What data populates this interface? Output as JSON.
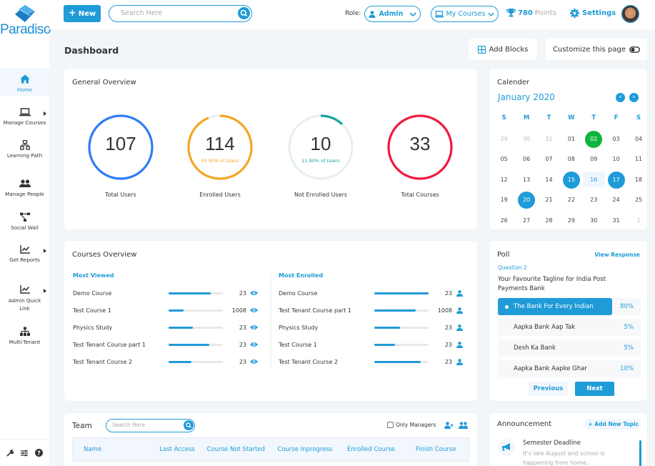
{
  "app": {
    "brand": "Paradiso"
  },
  "sidebar": {
    "items": [
      {
        "label": "Home",
        "icon": "home-icon",
        "active": true
      },
      {
        "label": "Manage Courses",
        "icon": "laptop-icon",
        "submenu": true
      },
      {
        "label": "Learning Path",
        "icon": "sitemap-icon"
      },
      {
        "label": "Manage People",
        "icon": "users-icon"
      },
      {
        "label": "Social Wall",
        "icon": "network-icon"
      },
      {
        "label": "Get Reports",
        "icon": "chart-line-icon",
        "submenu": true
      },
      {
        "label": "Admin Quick Link",
        "icon": "chart-line-icon",
        "submenu": true
      },
      {
        "label": "Multi-Tenant",
        "icon": "org-chart-icon"
      }
    ],
    "bottom_icons": [
      "wrench-icon",
      "sliders-icon",
      "help-icon"
    ]
  },
  "topbar": {
    "new_label": "New",
    "search_placeholder": "Search Here",
    "role_label": "Role:",
    "role_value": "Admin",
    "courses_label": "My Courses",
    "points_value": "780",
    "points_label": "Points",
    "settings_label": "Settings"
  },
  "header": {
    "title": "Dashboard",
    "add_blocks_label": "Add Blocks",
    "customize_label": "Customize this page"
  },
  "general_overview": {
    "title": "General Overview",
    "stats": [
      {
        "value": "107",
        "label": "Total Users",
        "sub": "",
        "color": "#2f7cf6",
        "fraction": 1.0
      },
      {
        "value": "114",
        "label": "Enrolled Users",
        "sub": "93.90% of Users",
        "color": "#f5a623",
        "fraction": 0.939
      },
      {
        "value": "10",
        "label": "Not Enrolled Users",
        "sub": "11.90% of Users",
        "color": "#14a3a3",
        "fraction": 0.119
      },
      {
        "value": "33",
        "label": "Total Courses",
        "sub": "",
        "color": "#f0193f",
        "fraction": 1.0
      }
    ]
  },
  "calendar": {
    "title": "Calender",
    "month": "January 2020",
    "weekdays": [
      "S",
      "M",
      "T",
      "W",
      "T",
      "F",
      "S"
    ],
    "weeks": [
      [
        {
          "d": "29",
          "m": 1
        },
        {
          "d": "30",
          "m": 1
        },
        {
          "d": "31",
          "m": 1
        },
        {
          "d": "01"
        },
        {
          "d": "02",
          "s": "green"
        },
        {
          "d": "03"
        },
        {
          "d": "04"
        }
      ],
      [
        {
          "d": "05"
        },
        {
          "d": "06"
        },
        {
          "d": "07"
        },
        {
          "d": "08"
        },
        {
          "d": "09"
        },
        {
          "d": "10"
        },
        {
          "d": "11"
        }
      ],
      [
        {
          "d": "12"
        },
        {
          "d": "13"
        },
        {
          "d": "14"
        },
        {
          "d": "15",
          "s": "blue"
        },
        {
          "d": "16",
          "s": "range"
        },
        {
          "d": "17",
          "s": "blue"
        },
        {
          "d": "18"
        }
      ],
      [
        {
          "d": "19"
        },
        {
          "d": "20",
          "s": "blue"
        },
        {
          "d": "21"
        },
        {
          "d": "22"
        },
        {
          "d": "23"
        },
        {
          "d": "24"
        },
        {
          "d": "25"
        }
      ],
      [
        {
          "d": "26"
        },
        {
          "d": "27"
        },
        {
          "d": "28"
        },
        {
          "d": "29"
        },
        {
          "d": "30"
        },
        {
          "d": "31"
        },
        {
          "d": "1",
          "m": 1
        }
      ]
    ]
  },
  "courses_overview": {
    "title": "Courses Overview",
    "most_viewed": {
      "label": "Most Viewed",
      "rows": [
        {
          "name": "Demo Course",
          "value": "23",
          "progress": 0.77
        },
        {
          "name": "Test Course 1",
          "value": "1008",
          "progress": 0.27
        },
        {
          "name": "Physics Study",
          "value": "23",
          "progress": 0.45
        },
        {
          "name": "Test Tenant Course part 1",
          "value": "23",
          "progress": 0.75
        },
        {
          "name": "Test Tenant Course 2",
          "value": "23",
          "progress": 0.42
        }
      ]
    },
    "most_enrolled": {
      "label": "Most Enrolled",
      "rows": [
        {
          "name": "Demo Course",
          "value": "23",
          "progress": 1.0
        },
        {
          "name": "Test Tenant Course part 1",
          "value": "1008",
          "progress": 0.76
        },
        {
          "name": "Physics Study",
          "value": "23",
          "progress": 0.48
        },
        {
          "name": "Test Course 1",
          "value": "23",
          "progress": 0.38
        },
        {
          "name": "Test Tenant Course 2",
          "value": "23",
          "progress": 0.85
        }
      ]
    }
  },
  "poll": {
    "title": "Poll",
    "view_response": "View Response",
    "question_label": "Question 2",
    "question": "Your Favourite Tagline for India Post Payments Bank",
    "options": [
      {
        "label": "The Bank For Every Indian",
        "pct": "80%",
        "selected": true
      },
      {
        "label": "Aapka Bank Aap Tak",
        "pct": "5%"
      },
      {
        "label": "Desh Ka Bank",
        "pct": "5%"
      },
      {
        "label": "Aapka Bank Aapke Ghar",
        "pct": "10%"
      }
    ],
    "previous_label": "Previous",
    "next_label": "Next"
  },
  "team": {
    "title": "Team",
    "search_placeholder": "Search Here",
    "only_managers_label": "Only Managers",
    "columns": [
      "Name",
      "Last Access",
      "Course Not Started",
      "Course Inprogress",
      "Enrolled Course",
      "Finish Course"
    ]
  },
  "announcement": {
    "title": "Announcement",
    "add_label": "+ Add New Topic",
    "items": [
      {
        "title": "Semester Deadline",
        "text": "It's late August and school is happening from home.."
      }
    ]
  }
}
